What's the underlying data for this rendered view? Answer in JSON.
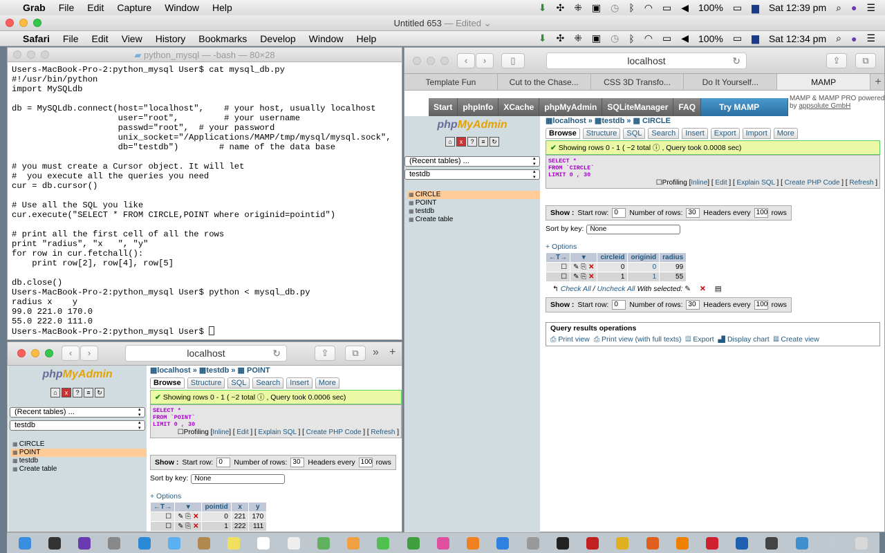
{
  "grab_menu": {
    "app": "Grab",
    "items": [
      "File",
      "Edit",
      "Capture",
      "Window",
      "Help"
    ],
    "battery": "100%",
    "time": "Sat 12:39 pm"
  },
  "grab_window_title": "Untitled 653",
  "grab_edited": "— Edited ⌄",
  "safari_menu": {
    "app": "Safari",
    "items": [
      "File",
      "Edit",
      "View",
      "History",
      "Bookmarks",
      "Develop",
      "Window",
      "Help"
    ],
    "battery": "100%",
    "time": "Sat 12:34 pm"
  },
  "terminal": {
    "title": "python_mysql — -bash — 80×28",
    "lines": [
      "Users-MacBook-Pro-2:python_mysql User$ cat mysql_db.py",
      "#!/usr/bin/python",
      "import MySQLdb",
      "",
      "db = MySQLdb.connect(host=\"localhost\",    # your host, usually localhost",
      "                     user=\"root\",         # your username",
      "                     passwd=\"root\",  # your password",
      "                     unix_socket=\"/Applications/MAMP/tmp/mysql/mysql.sock\",",
      "                     db=\"testdb\")        # name of the data base",
      "",
      "# you must create a Cursor object. It will let",
      "#  you execute all the queries you need",
      "cur = db.cursor()",
      "",
      "# Use all the SQL you like",
      "cur.execute(\"SELECT * FROM CIRCLE,POINT where originid=pointid\")",
      "",
      "# print all the first cell of all the rows",
      "print \"radius\", \"x   \", \"y\"",
      "for row in cur.fetchall():",
      "    print row[2], row[4], row[5]",
      "",
      "db.close()",
      "Users-MacBook-Pro-2:python_mysql User$ python < mysql_db.py",
      "radius x    y",
      "99.0 221.0 170.0",
      "55.0 222.0 111.0"
    ],
    "prompt": "Users-MacBook-Pro-2:python_mysql User$ "
  },
  "safari_big": {
    "address": "localhost",
    "tabs": [
      "Template Fun",
      "Cut to the Chase...",
      "CSS 3D Transfo...",
      "Do It Yourself...",
      "MAMP"
    ],
    "active_tab": 4
  },
  "mamp": {
    "buttons": [
      "Start",
      "phpInfo",
      "XCache",
      "phpMyAdmin",
      "SQLiteManager",
      "FAQ"
    ],
    "try": "Try MAMP PRO",
    "powered": "MAMP & MAMP PRO powered by",
    "powered_link": "appsolute GmbH"
  },
  "pma_common": {
    "logo_a": "php",
    "logo_b": "MyAdmin",
    "recent": "(Recent tables) ...",
    "db": "testdb",
    "tables": [
      "CIRCLE",
      "POINT"
    ],
    "dbitem": "testdb",
    "create": "Create table",
    "tabs": [
      "Browse",
      "Structure",
      "SQL",
      "Search",
      "Insert",
      "Export",
      "Import",
      "More"
    ],
    "profiling": "Profiling",
    "links": [
      "Inline",
      "Edit",
      "Explain SQL",
      "Create PHP Code",
      "Refresh"
    ],
    "show": "Show :",
    "start_row": "Start row:",
    "start_val": "0",
    "num_rows": "Number of rows:",
    "num_val": "30",
    "headers_every": "Headers every",
    "headers_val": "100",
    "rows": "rows",
    "sort_by": "Sort by key:",
    "sort_val": "None",
    "options": "+ Options",
    "check_all": "Check All",
    "slash": " / ",
    "uncheck_all": "Uncheck All",
    "with_selected": "With selected:",
    "qro_title": "Query results operations",
    "qro": [
      "Print view",
      "Print view (with full texts)",
      "Export",
      "Display chart",
      "Create view"
    ],
    "arrows": "←T→"
  },
  "pma_circle": {
    "crumb": [
      "localhost",
      "testdb",
      "CIRCLE"
    ],
    "success": "Showing rows 0 - 1 ( ~2 total",
    "success_b": ", Query took 0.0008 sec)",
    "sql": [
      "SELECT *",
      "FROM `CIRCLE`",
      "LIMIT 0 , 30"
    ],
    "cols": [
      "circleid",
      "originid",
      "radius"
    ],
    "rows": [
      [
        "0",
        "0",
        "99"
      ],
      [
        "1",
        "1",
        "55"
      ]
    ]
  },
  "pma_point": {
    "crumb": [
      "localhost",
      "testdb",
      "POINT"
    ],
    "success": "Showing rows 0 - 1 ( ~2 total",
    "success_b": ", Query took 0.0006 sec)",
    "sql": [
      "SELECT *",
      "FROM `POINT`",
      "LIMIT 0 , 30"
    ],
    "cols": [
      "pointid",
      "x",
      "y"
    ],
    "rows": [
      [
        "0",
        "221",
        "170"
      ],
      [
        "1",
        "222",
        "111"
      ]
    ]
  },
  "safari_small": {
    "address": "localhost"
  }
}
